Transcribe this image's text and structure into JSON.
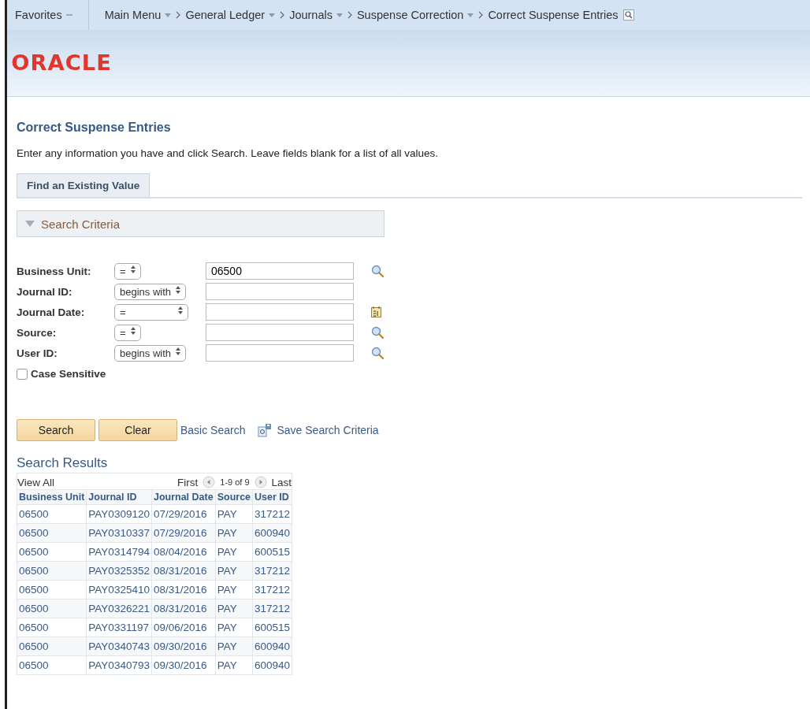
{
  "nav": {
    "favorites": "Favorites",
    "breadcrumbs": [
      {
        "label": "Main Menu",
        "menu": true
      },
      {
        "label": "General Ledger",
        "menu": true
      },
      {
        "label": "Journals",
        "menu": true
      },
      {
        "label": "Suspense Correction",
        "menu": true
      },
      {
        "label": "Correct Suspense Entries",
        "menu": false
      }
    ]
  },
  "logo": "ORACLE",
  "page_title": "Correct Suspense Entries",
  "instructions": "Enter any information you have and click Search. Leave fields blank for a list of all values.",
  "tabs": [
    {
      "label": "Find an Existing Value",
      "selected": true
    }
  ],
  "search_criteria": {
    "title": "Search Criteria",
    "expanded": true,
    "fields": [
      {
        "label": "Business Unit:",
        "operator": "=",
        "value": "06500",
        "kind": "lookup"
      },
      {
        "label": "Journal ID:",
        "operator": "begins with",
        "kind": "plain"
      },
      {
        "label": "Journal Date:",
        "operator": "=",
        "kind": "date"
      },
      {
        "label": "Source:",
        "operator": "=",
        "kind": "lookup"
      },
      {
        "label": "User ID:",
        "operator": "begins with",
        "kind": "lookup"
      }
    ],
    "case_sensitive": {
      "label": "Case Sensitive",
      "checked": false
    }
  },
  "buttons": [
    "Search",
    "Clear"
  ],
  "links": [
    "Basic Search",
    "Save Search Criteria"
  ],
  "results": {
    "title": "Search Results",
    "view_all": "View All",
    "first": "First",
    "range": "1-9 of 9",
    "last": "Last",
    "columns": [
      "Business Unit",
      "Journal ID",
      "Journal Date",
      "Source",
      "User ID"
    ],
    "rows": [
      [
        "06500",
        "PAY0309120",
        "07/29/2016",
        "PAY",
        "317212"
      ],
      [
        "06500",
        "PAY0310337",
        "07/29/2016",
        "PAY",
        "600940"
      ],
      [
        "06500",
        "PAY0314794",
        "08/04/2016",
        "PAY",
        "600515"
      ],
      [
        "06500",
        "PAY0325352",
        "08/31/2016",
        "PAY",
        "317212"
      ],
      [
        "06500",
        "PAY0325410",
        "08/31/2016",
        "PAY",
        "317212"
      ],
      [
        "06500",
        "PAY0326221",
        "08/31/2016",
        "PAY",
        "317212"
      ],
      [
        "06500",
        "PAY0331197",
        "09/06/2016",
        "PAY",
        "600515"
      ],
      [
        "06500",
        "PAY0340743",
        "09/30/2016",
        "PAY",
        "600940"
      ],
      [
        "06500",
        "PAY0340793",
        "09/30/2016",
        "PAY",
        "600940"
      ]
    ]
  }
}
